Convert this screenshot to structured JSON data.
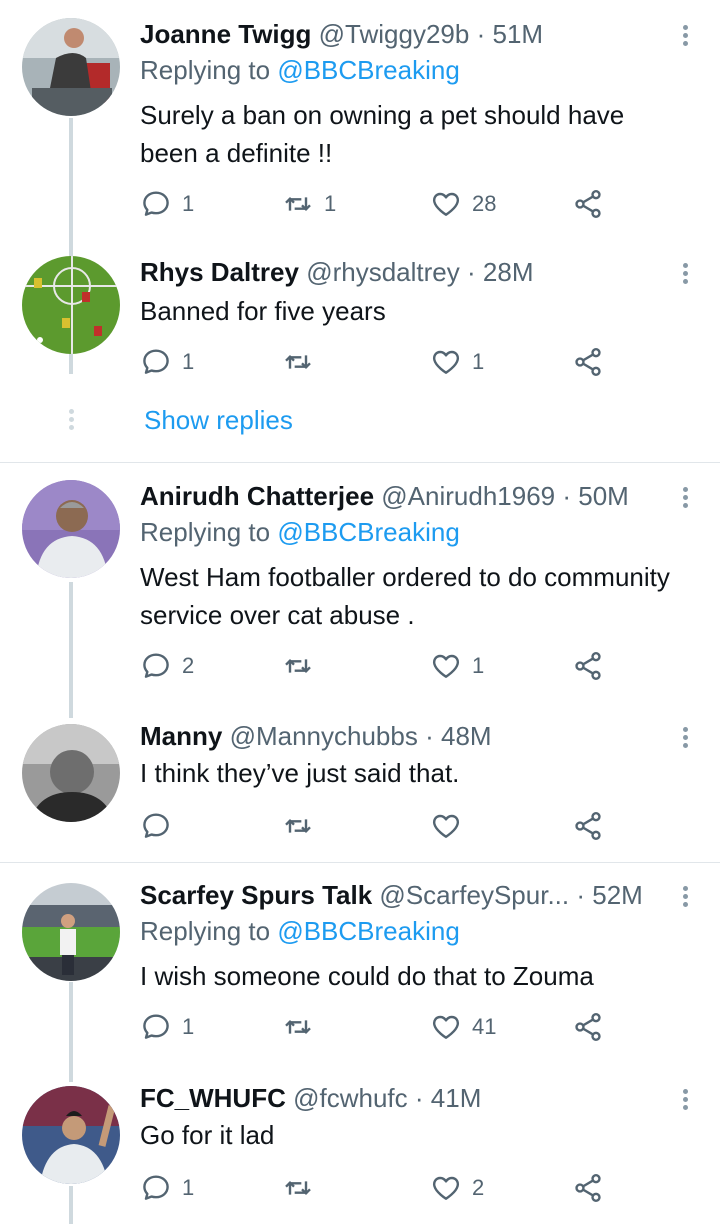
{
  "accent_color": "#1d9bf0",
  "tweets": [
    {
      "name": "Joanne Twigg",
      "handle": "@Twiggy29b",
      "dot": "·",
      "time": "51M",
      "replying_prefix": "Replying to",
      "replying_to": "@BBCBreaking",
      "text": "Surely a ban on owning a pet should have been a definite !!",
      "replies": "1",
      "retweets": "1",
      "likes": "28"
    },
    {
      "name": "Rhys Daltrey",
      "handle": "@rhysdaltrey",
      "dot": "·",
      "time": "28M",
      "text": "Banned for five years",
      "replies": "1",
      "retweets": "",
      "likes": "1"
    },
    {
      "name": "Anirudh Chatterjee",
      "handle": "@Anirudh1969",
      "dot": "·",
      "time": "50M",
      "replying_prefix": "Replying to",
      "replying_to": "@BBCBreaking",
      "text": "West Ham footballer ordered to do community service over cat abuse .",
      "replies": "2",
      "retweets": "",
      "likes": "1"
    },
    {
      "name": "Manny",
      "handle": "@Mannychubbs",
      "dot": "·",
      "time": "48M",
      "text": "I think they’ve just said that.",
      "replies": "",
      "retweets": "",
      "likes": ""
    },
    {
      "name": "Scarfey Spurs Talk",
      "handle": "@ScarfeySpur...",
      "dot": "·",
      "time": "52M",
      "replying_prefix": "Replying to",
      "replying_to": "@BBCBreaking",
      "text": "I wish someone could do that to Zouma",
      "replies": "1",
      "retweets": "",
      "likes": "41"
    },
    {
      "name": "FC_WHUFC",
      "handle": "@fcwhufc",
      "dot": "·",
      "time": "41M",
      "text": "Go for it lad",
      "replies": "1",
      "retweets": "",
      "likes": "2"
    }
  ],
  "show_replies_label": "Show replies",
  "icons": {
    "reply": "reply-icon",
    "retweet": "retweet-icon",
    "like": "heart-icon",
    "share": "share-icon",
    "more": "more-options-icon"
  }
}
